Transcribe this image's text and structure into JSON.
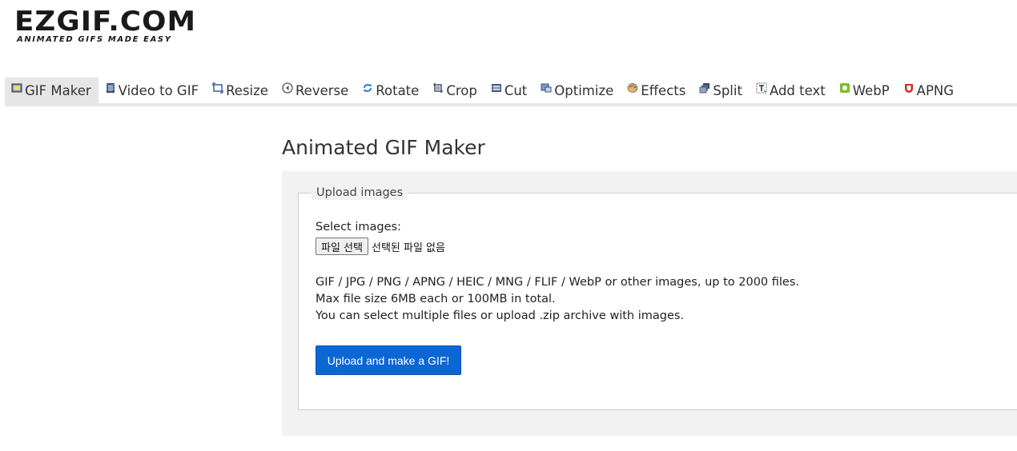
{
  "logo": {
    "main": "EZGIF.COM",
    "tagline": "ANIMATED GIFS MADE EASY"
  },
  "nav": [
    {
      "label": "GIF Maker",
      "icon": "gif-maker-icon",
      "active": true
    },
    {
      "label": "Video to GIF",
      "icon": "film-icon"
    },
    {
      "label": "Resize",
      "icon": "resize-icon"
    },
    {
      "label": "Reverse",
      "icon": "reverse-icon"
    },
    {
      "label": "Rotate",
      "icon": "rotate-icon"
    },
    {
      "label": "Crop",
      "icon": "crop-icon"
    },
    {
      "label": "Cut",
      "icon": "cut-icon"
    },
    {
      "label": "Optimize",
      "icon": "optimize-icon"
    },
    {
      "label": "Effects",
      "icon": "palette-icon"
    },
    {
      "label": "Split",
      "icon": "split-icon"
    },
    {
      "label": "Add text",
      "icon": "add-text-icon"
    },
    {
      "label": "WebP",
      "icon": "webp-icon"
    },
    {
      "label": "APNG",
      "icon": "apng-icon"
    }
  ],
  "page": {
    "title": "Animated GIF Maker"
  },
  "upload": {
    "legend": "Upload images",
    "select_label": "Select images:",
    "file_button": "파일 선택",
    "file_status": "선택된 파일 없음",
    "info_lines": [
      "GIF / JPG / PNG / APNG / HEIC / MNG / FLIF / WebP or other images, up to 2000 files.",
      "Max file size 6MB each or 100MB in total.",
      "You can select multiple files or upload .zip archive with images."
    ],
    "submit_label": "Upload and make a GIF!"
  },
  "colors": {
    "accent": "#0c67d4",
    "nav_active_bg": "#e6e6e6",
    "panel_bg": "#f2f2f2"
  }
}
